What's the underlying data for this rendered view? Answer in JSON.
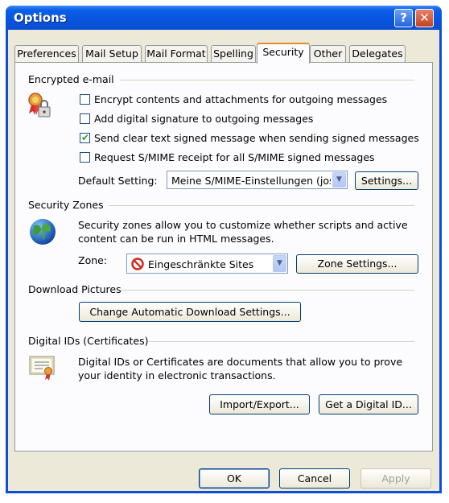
{
  "window": {
    "title": "Options",
    "help_glyph": "?",
    "close_glyph": "✕"
  },
  "tabs": [
    {
      "label": "Preferences",
      "active": false
    },
    {
      "label": "Mail Setup",
      "active": false
    },
    {
      "label": "Mail Format",
      "active": false
    },
    {
      "label": "Spelling",
      "active": false
    },
    {
      "label": "Security",
      "active": true
    },
    {
      "label": "Other",
      "active": false
    },
    {
      "label": "Delegates",
      "active": false
    }
  ],
  "encrypted": {
    "heading": "Encrypted e-mail",
    "icon": "certificate-lock-icon",
    "checkboxes": [
      {
        "label": "Encrypt contents and attachments for outgoing messages",
        "checked": false
      },
      {
        "label": "Add digital signature to outgoing messages",
        "checked": false
      },
      {
        "label": "Send clear text signed message when sending signed messages",
        "checked": true
      },
      {
        "label": "Request S/MIME receipt for all S/MIME signed messages",
        "checked": false
      }
    ],
    "default_setting_label": "Default Setting:",
    "default_setting_value": "Meine S/MIME-Einstellungen (jose",
    "settings_button": "Settings..."
  },
  "zones": {
    "heading": "Security Zones",
    "icon": "globe-icon",
    "description": "Security zones allow you to customize whether scripts and active content can be run in HTML messages.",
    "zone_label": "Zone:",
    "zone_value": "Eingeschränkte Sites",
    "zone_icon": "restricted-icon",
    "zone_settings_button": "Zone Settings..."
  },
  "download": {
    "heading": "Download Pictures",
    "button": "Change Automatic Download Settings..."
  },
  "digital_ids": {
    "heading": "Digital IDs (Certificates)",
    "icon": "certificate-icon",
    "description": "Digital IDs or Certificates are documents that allow you to prove your identity in electronic transactions.",
    "import_export_button": "Import/Export...",
    "get_id_button": "Get a Digital ID..."
  },
  "footer": {
    "ok": "OK",
    "cancel": "Cancel",
    "apply": "Apply"
  },
  "colors": {
    "title_blue": "#0753de",
    "dialog_bg": "#ece9d8",
    "tab_accent": "#e68b2c",
    "check_green": "#21a121"
  }
}
